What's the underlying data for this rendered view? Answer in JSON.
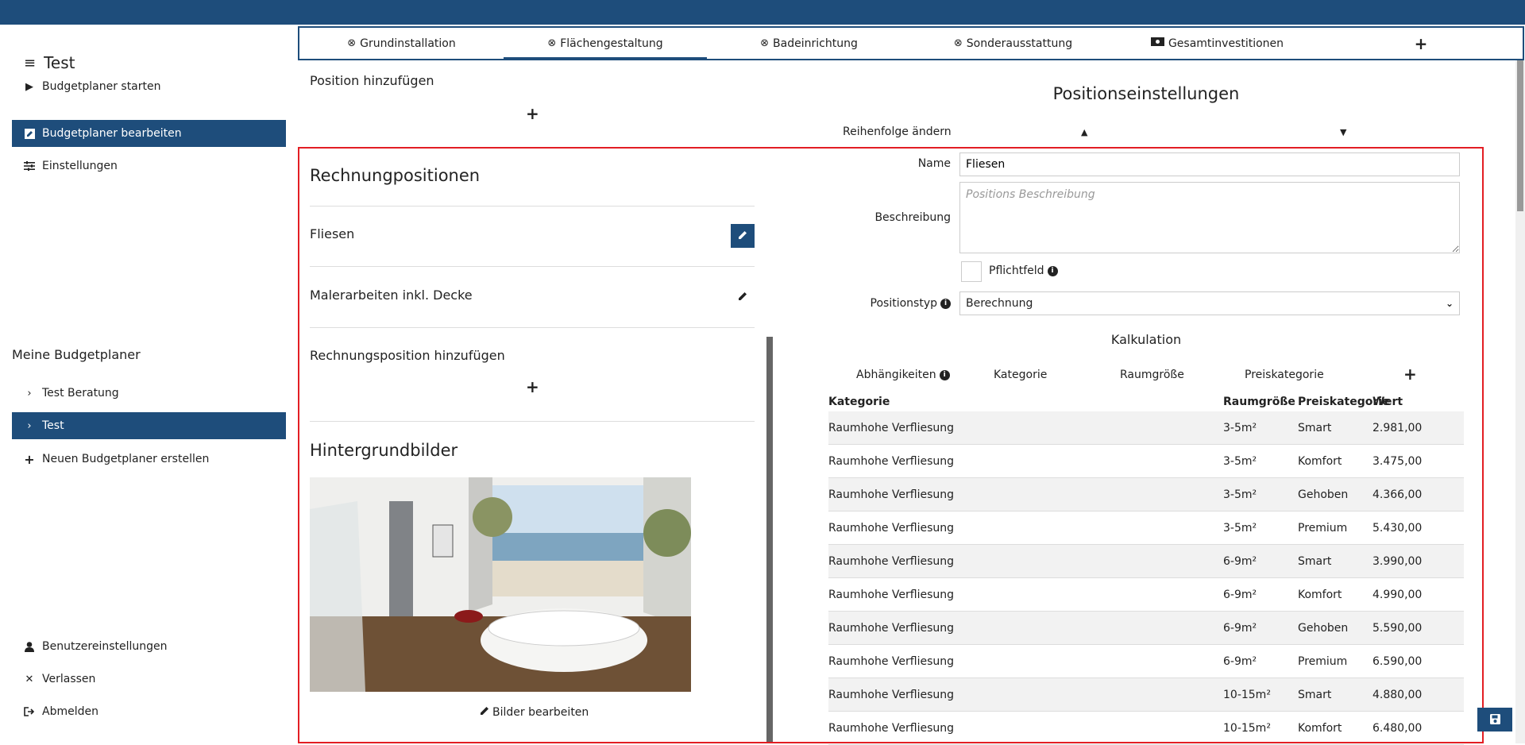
{
  "sidebar": {
    "title": "Test",
    "main_nav": [
      {
        "label": "Budgetplaner starten",
        "icon": "play-icon"
      },
      {
        "label": "Budgetplaner bearbeiten",
        "icon": "edit-square-icon",
        "active": true
      },
      {
        "label": "Einstellungen",
        "icon": "sliders-icon"
      }
    ],
    "section_title": "Meine Budgetplaner",
    "planners": [
      {
        "label": "Test Beratung",
        "icon": "chevron-right-icon"
      },
      {
        "label": "Test",
        "icon": "chevron-right-icon",
        "active": true
      },
      {
        "label": "Neuen Budgetplaner erstellen",
        "icon": "plus-icon"
      }
    ],
    "bottom_nav": [
      {
        "label": "Benutzereinstellungen",
        "icon": "user-icon"
      },
      {
        "label": "Verlassen",
        "icon": "close-icon"
      },
      {
        "label": "Abmelden",
        "icon": "logout-icon"
      }
    ]
  },
  "tabs": [
    {
      "label": "Grundinstallation",
      "icon": "circle-x-icon"
    },
    {
      "label": "Flächengestaltung",
      "icon": "circle-x-icon",
      "active": true
    },
    {
      "label": "Badeinrichtung",
      "icon": "circle-x-icon"
    },
    {
      "label": "Sonderausstattung",
      "icon": "circle-x-icon"
    },
    {
      "label": "Gesamtinvestitionen",
      "icon": "money-icon"
    },
    {
      "label": "+",
      "icon": "plus-icon"
    }
  ],
  "left": {
    "position_add": "Position hinzufügen",
    "rechnung_title": "Rechnungpositionen",
    "positions": [
      "Fliesen",
      "Malerarbeiten inkl. Decke"
    ],
    "rechnung_add": "Rechnungsposition hinzufügen",
    "bg_title": "Hintergrundbilder",
    "bilder_edit": "Bilder bearbeiten"
  },
  "right": {
    "title": "Positionseinstellungen",
    "order_label": "Reihenfolge ändern",
    "name_label": "Name",
    "name_value": "Fliesen",
    "desc_label": "Beschreibung",
    "desc_placeholder": "Positions Beschreibung",
    "pflicht_label": "Pflichtfeld",
    "typ_label": "Positionstyp",
    "typ_value": "Berechnung",
    "kalk_title": "Kalkulation",
    "kalk_cols": [
      "Abhängikeiten",
      "Kategorie",
      "Raumgröße",
      "Preiskategorie"
    ],
    "table_headers": [
      "Kategorie",
      "Raumgröße",
      "Preiskategorie",
      "Wert"
    ],
    "rows": [
      [
        "Raumhohe Verfliesung",
        "3-5m²",
        "Smart",
        "2.981,00"
      ],
      [
        "Raumhohe Verfliesung",
        "3-5m²",
        "Komfort",
        "3.475,00"
      ],
      [
        "Raumhohe Verfliesung",
        "3-5m²",
        "Gehoben",
        "4.366,00"
      ],
      [
        "Raumhohe Verfliesung",
        "3-5m²",
        "Premium",
        "5.430,00"
      ],
      [
        "Raumhohe Verfliesung",
        "6-9m²",
        "Smart",
        "3.990,00"
      ],
      [
        "Raumhohe Verfliesung",
        "6-9m²",
        "Komfort",
        "4.990,00"
      ],
      [
        "Raumhohe Verfliesung",
        "6-9m²",
        "Gehoben",
        "5.590,00"
      ],
      [
        "Raumhohe Verfliesung",
        "6-9m²",
        "Premium",
        "6.590,00"
      ],
      [
        "Raumhohe Verfliesung",
        "10-15m²",
        "Smart",
        "4.880,00"
      ],
      [
        "Raumhohe Verfliesung",
        "10-15m²",
        "Komfort",
        "6.480,00"
      ]
    ]
  },
  "colors": {
    "primary": "#1e4d7b",
    "highlight": "#e31e24"
  }
}
